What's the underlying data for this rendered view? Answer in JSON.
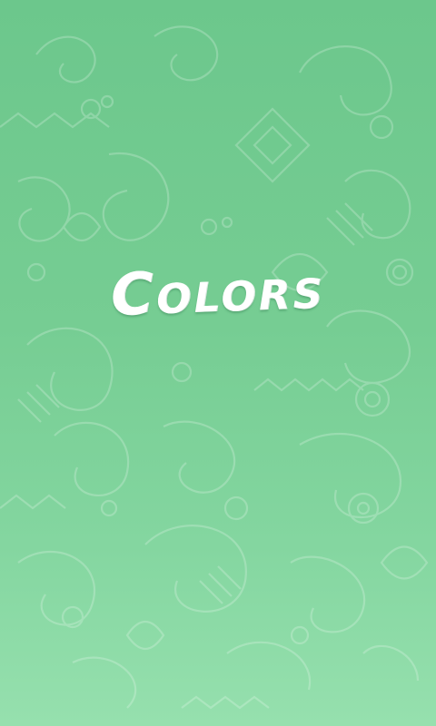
{
  "splash": {
    "title": "Colors",
    "background_colors": [
      "#6cc78c",
      "#96e0ae"
    ],
    "pattern_color": "#ffffff",
    "background_pattern": "doodle-pattern"
  }
}
